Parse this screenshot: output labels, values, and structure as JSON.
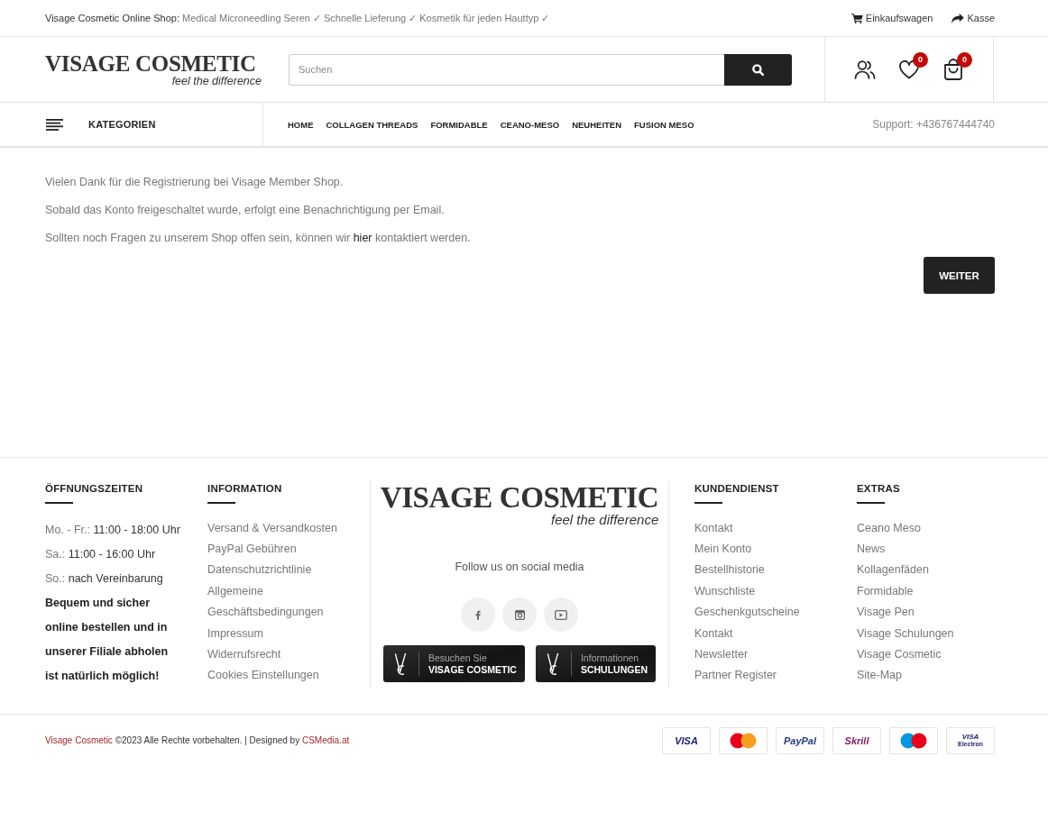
{
  "top_bar": {
    "shop_label": "Visage Cosmetic Online Shop:",
    "tagline": "Medical Microneedling Seren ✓ Schnelle Lieferung ✓ Kosmetik für jeden Hauttyp ✓",
    "links": [
      {
        "kind": "cart",
        "label": "Einkaufswagen"
      },
      {
        "kind": "checkout",
        "label": "Kasse"
      }
    ]
  },
  "header": {
    "logo": {
      "name": "VISAGE COSMETIC",
      "slogan": "feel the difference"
    },
    "search": {
      "placeholder": "Suchen"
    },
    "actions": [
      {
        "kind": "account"
      },
      {
        "kind": "wishlist",
        "badge": "0"
      },
      {
        "kind": "bag",
        "badge": "0"
      }
    ]
  },
  "nav": {
    "categories_label": "KATEGORIEN",
    "items": [
      "HOME",
      "COLLAGEN THREADS",
      "FORMIDABLE",
      "CEANO-MESO",
      "NEUHEITEN",
      "FUSION MESO"
    ],
    "support": "Support: +436767444740"
  },
  "content": {
    "paragraphs": [
      {
        "text": "Vielen Dank für die Registrierung bei Visage Member Shop."
      },
      {
        "text": "Sobald das Konto freigeschaltet wurde, erfolgt eine Benachrichtigung per Email."
      },
      {
        "text": "Sollten noch Fragen zu unserem Shop offen sein, können wir",
        "link": "hier",
        "after": "kontaktiert werden."
      }
    ],
    "continue_button": "WEITER"
  },
  "footer": {
    "hours": {
      "title": "ÖFFNUNGSZEITEN",
      "rows": [
        {
          "label": "Mo. - Fr.:",
          "value": "11:00 - 18:00 Uhr"
        },
        {
          "label": "Sa.:",
          "value": "11:00 - 16:00 Uhr"
        },
        {
          "label": "So.:",
          "value": "nach Vereinbarung"
        }
      ],
      "note": "Bequem und sicher online bestellen und in unserer Filiale abholen ist natürlich möglich!"
    },
    "information": {
      "title": "INFORMATION",
      "links": [
        "Versand & Versandkosten",
        "PayPal Gebühren",
        "Datenschutzrichtlinie",
        "Allgemeine Geschäftsbedingungen",
        "Impressum",
        "Widerrufsrecht",
        "Cookies Einstellungen"
      ]
    },
    "brand": {
      "logo": {
        "name": "VISAGE COSMETIC",
        "slogan": "feel the difference"
      },
      "social_text": "Follow us on social media",
      "social": [
        {
          "kind": "facebook"
        },
        {
          "kind": "instagram"
        },
        {
          "kind": "youtube"
        }
      ],
      "banners": [
        {
          "line_1": "Besuchen Sie",
          "line_2": "VISAGE COSMETIC"
        },
        {
          "line_1": "Informationen",
          "line_2": "SCHULUNGEN"
        }
      ]
    },
    "customer_service": {
      "title": "KUNDENDIENST",
      "links": [
        "Kontakt",
        "Mein Konto",
        "Bestellhistorie",
        "Wunschliste",
        "Geschenkgutscheine",
        "Kontakt",
        "Newsletter",
        "Partner Register"
      ]
    },
    "extras": {
      "title": "EXTRAS",
      "links": [
        "Ceano Meso",
        "News",
        "Kollagenfäden",
        "Formidable",
        "Visage Pen",
        "Visage Schulungen",
        "Visage Cosmetic",
        "Site-Map"
      ]
    }
  },
  "bottom_bar": {
    "company": "Visage Cosmetic",
    "rights": "©2023 Alle Rechte vorbehalten. | Designed by",
    "designer": "CSMedia.at",
    "payments": [
      {
        "kind": "wordmark",
        "label": "VISA",
        "color": "#1a1f71"
      },
      {
        "kind": "circles",
        "circles": [
          {
            "color": "#eb001b"
          },
          {
            "color": "#f79e1b"
          }
        ]
      },
      {
        "kind": "wordmark",
        "label": "PayPal",
        "color": "#253b80"
      },
      {
        "kind": "wordmark",
        "label": "Skrill",
        "color": "#862165"
      },
      {
        "kind": "circles",
        "circles": [
          {
            "color": "#0099df"
          },
          {
            "color": "#eb001b"
          }
        ]
      },
      {
        "kind": "stacked",
        "label": "VISA",
        "sublabel": "Electron",
        "color": "#1a1f71"
      }
    ]
  }
}
